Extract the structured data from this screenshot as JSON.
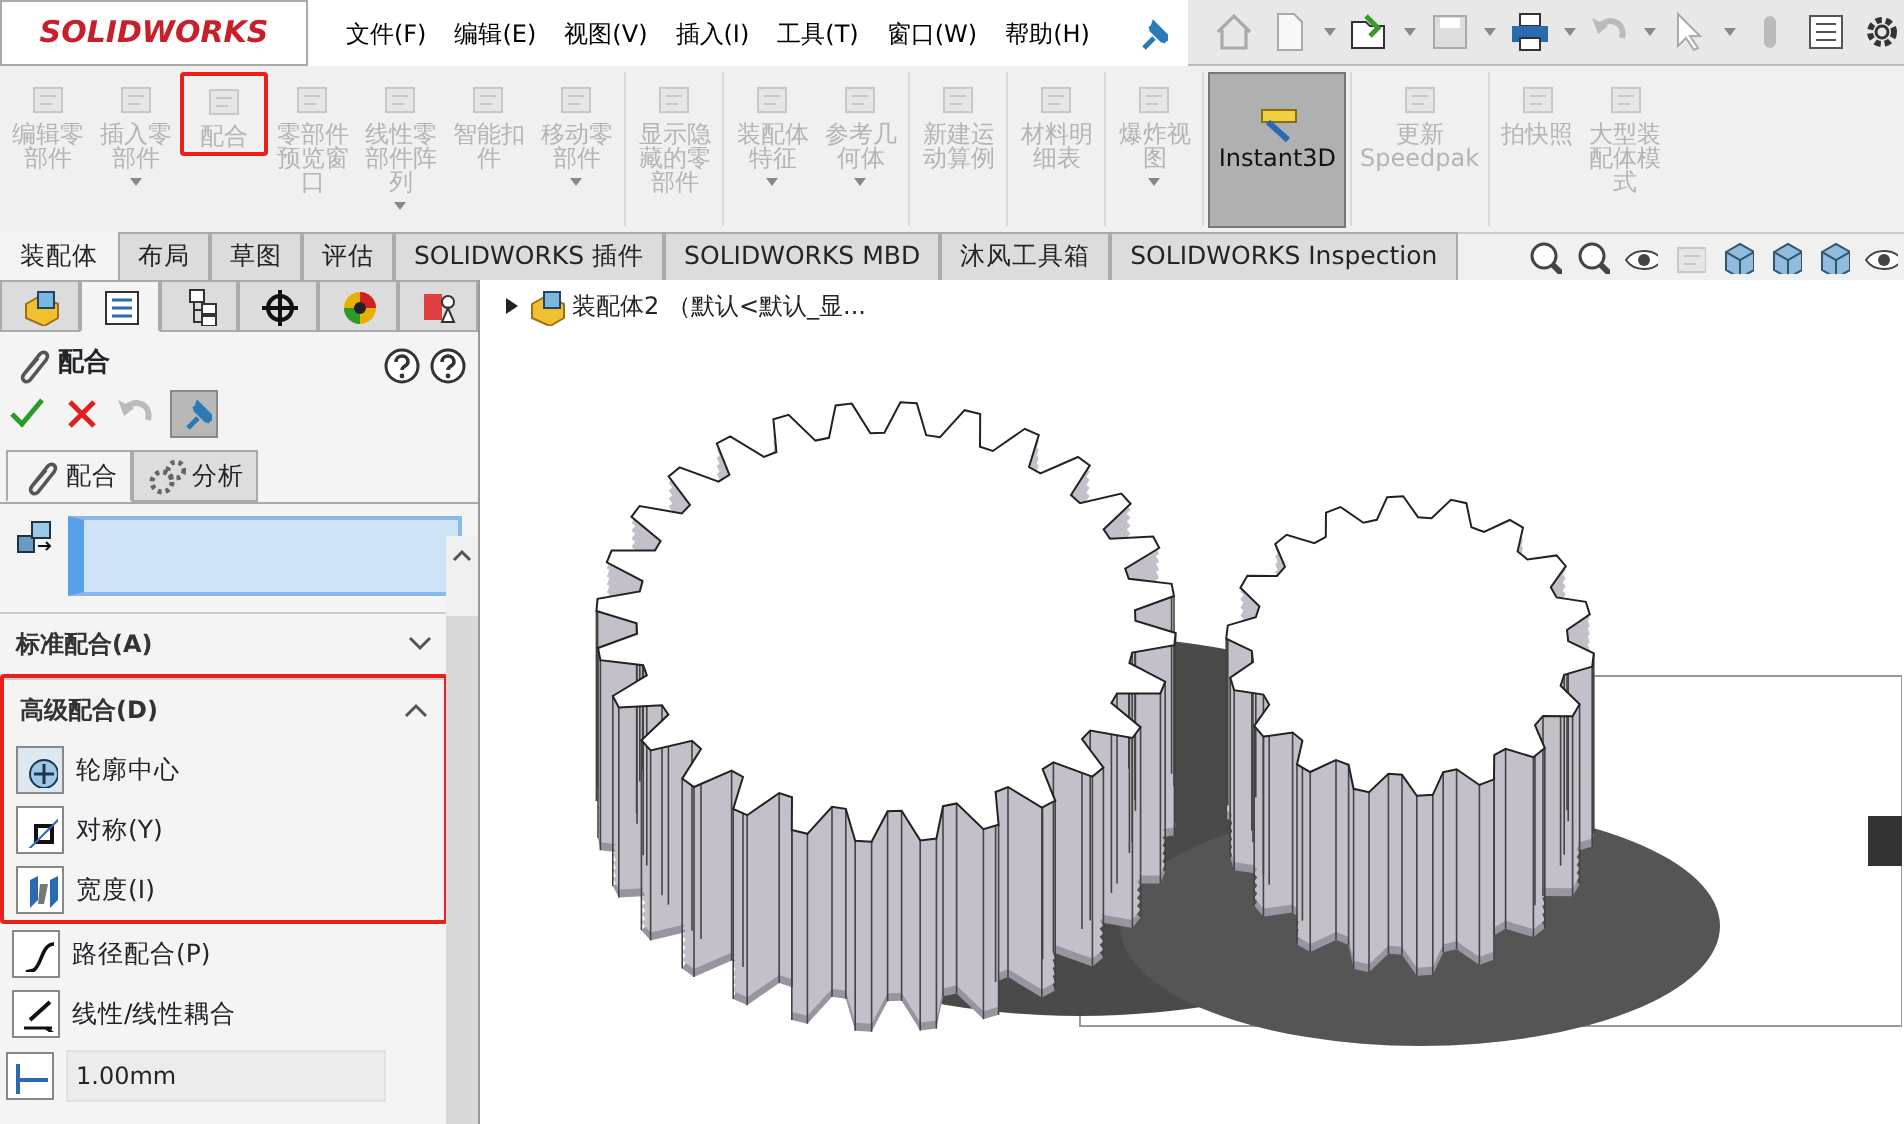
{
  "app": {
    "logo": "SOLIDWORKS"
  },
  "menu": [
    {
      "label": "文件(F)"
    },
    {
      "label": "编辑(E)"
    },
    {
      "label": "视图(V)"
    },
    {
      "label": "插入(I)"
    },
    {
      "label": "工具(T)"
    },
    {
      "label": "窗口(W)"
    },
    {
      "label": "帮助(H)"
    }
  ],
  "ribbon": [
    {
      "label": "编辑零部件",
      "disabled": true,
      "dropdown": false,
      "selected": false,
      "annotated": false,
      "sep": false
    },
    {
      "label": "插入零部件",
      "disabled": true,
      "dropdown": true,
      "selected": false,
      "annotated": false,
      "sep": false
    },
    {
      "label": "配合",
      "disabled": true,
      "dropdown": false,
      "selected": false,
      "annotated": true,
      "sep": false
    },
    {
      "label": "零部件预览窗口",
      "disabled": true,
      "dropdown": false,
      "selected": false,
      "annotated": false,
      "sep": false
    },
    {
      "label": "线性零部件阵列",
      "disabled": true,
      "dropdown": true,
      "selected": false,
      "annotated": false,
      "sep": false
    },
    {
      "label": "智能扣件",
      "disabled": true,
      "dropdown": false,
      "selected": false,
      "annotated": false,
      "sep": false
    },
    {
      "label": "移动零部件",
      "disabled": true,
      "dropdown": true,
      "selected": false,
      "annotated": false,
      "sep": false
    },
    {
      "label": "显示隐藏的零部件",
      "disabled": true,
      "dropdown": false,
      "selected": false,
      "annotated": false,
      "sep": true
    },
    {
      "label": "装配体特征",
      "disabled": true,
      "dropdown": true,
      "selected": false,
      "annotated": false,
      "sep": true
    },
    {
      "label": "参考几何体",
      "disabled": true,
      "dropdown": true,
      "selected": false,
      "annotated": false,
      "sep": false
    },
    {
      "label": "新建运动算例",
      "disabled": true,
      "dropdown": false,
      "selected": false,
      "annotated": false,
      "sep": true
    },
    {
      "label": "材料明细表",
      "disabled": true,
      "dropdown": false,
      "selected": false,
      "annotated": false,
      "sep": true
    },
    {
      "label": "爆炸视图",
      "disabled": true,
      "dropdown": true,
      "selected": false,
      "annotated": false,
      "sep": true
    },
    {
      "label": "Instant3D",
      "disabled": false,
      "dropdown": false,
      "selected": true,
      "annotated": false,
      "sep": true
    },
    {
      "label": "更新 Speedpak",
      "disabled": true,
      "dropdown": false,
      "selected": false,
      "annotated": false,
      "sep": true
    },
    {
      "label": "拍快照",
      "disabled": true,
      "dropdown": false,
      "selected": false,
      "annotated": false,
      "sep": true
    },
    {
      "label": "大型装配体模式",
      "disabled": true,
      "dropdown": false,
      "selected": false,
      "annotated": false,
      "sep": false
    }
  ],
  "tabs": [
    {
      "label": "装配体",
      "selected": true
    },
    {
      "label": "布局",
      "selected": false
    },
    {
      "label": "草图",
      "selected": false
    },
    {
      "label": "评估",
      "selected": false
    },
    {
      "label": "SOLIDWORKS 插件",
      "selected": false
    },
    {
      "label": "SOLIDWORKS MBD",
      "selected": false
    },
    {
      "label": "沐风工具箱",
      "selected": false
    },
    {
      "label": "SOLIDWORKS Inspection",
      "selected": false
    }
  ],
  "panel": {
    "icon_tabs": [
      {
        "selected": false
      },
      {
        "selected": true
      },
      {
        "selected": false
      },
      {
        "selected": false
      },
      {
        "selected": false
      },
      {
        "selected": false
      }
    ],
    "title": "配合",
    "sub_tabs": [
      {
        "label": "配合",
        "selected": true
      },
      {
        "label": "分析",
        "selected": false
      }
    ],
    "sections": [
      {
        "title": "标准配合(A)",
        "expanded": false,
        "annotated": false
      },
      {
        "title": "高级配合(D)",
        "expanded": true,
        "annotated": true
      }
    ],
    "items": [
      {
        "label": "轮廓中心",
        "selected": true,
        "annotated": true
      },
      {
        "label": "对称(Y)",
        "selected": false,
        "annotated": true
      },
      {
        "label": "宽度(I)",
        "selected": false,
        "annotated": true
      },
      {
        "label": "路径配合(P)",
        "selected": false,
        "annotated": false
      },
      {
        "label": "线性/线性耦合",
        "selected": false,
        "annotated": false
      }
    ],
    "distance": {
      "value": "1.00mm"
    }
  },
  "tree": {
    "label": "装配体2 （默认<默认_显..."
  }
}
